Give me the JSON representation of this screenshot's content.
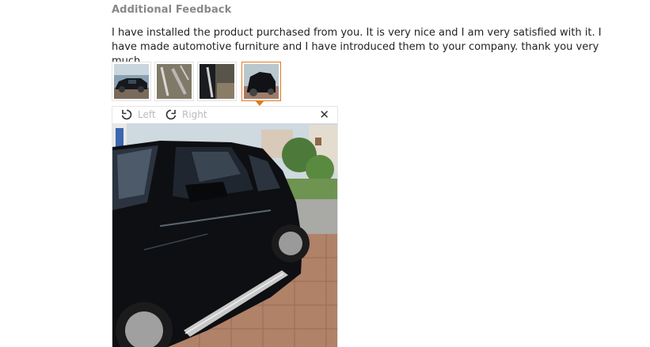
{
  "feedback": {
    "title": "Additional Feedback",
    "text": "I have installed the product purchased from you. It is very nice and I am very satisfied with it. I have made automotive furniture and I have introduced them to your company. thank you very much"
  },
  "thumbnails": [
    {
      "icon": "photo-car-side-thumbnail"
    },
    {
      "icon": "photo-step-bar-thumbnail"
    },
    {
      "icon": "photo-step-installed-thumbnail"
    },
    {
      "icon": "photo-car-front-thumbnail",
      "selected": true
    }
  ],
  "viewer": {
    "rotate_left_label": "Left",
    "rotate_right_label": "Right",
    "close_glyph": "✕"
  },
  "colors": {
    "accent": "#e07a1f",
    "title": "#888888",
    "text": "#222222",
    "disabled": "#bbbbbb"
  }
}
